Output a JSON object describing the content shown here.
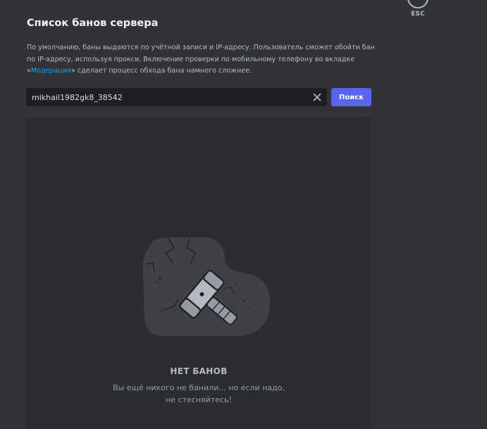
{
  "close": {
    "label": "ESC"
  },
  "page_title": "Список банов сервера",
  "description": {
    "line1": "По умолчанию, баны выдаются по учётной записи и IP-адресу. Пользователь сможет обойти бан",
    "line2": "по IP-адресу, используя прокси. Включение проверки по мобильному телефону во вкладке",
    "line3_open_quote": "«",
    "line3_link": "Модерация",
    "line3_rest": "» сделает процесс обхода бана намного сложнее."
  },
  "search": {
    "value": "mikhail1982gk8_38542",
    "button_label": "Поиск",
    "clear_icon": "close-icon"
  },
  "empty_state": {
    "illustration": "ban-hammer-icon",
    "title": "НЕТ БАНОВ",
    "subtitle_line1": "Вы ещё никого не банили... но если надо,",
    "subtitle_line2": "не стесняйтесь!"
  },
  "colors": {
    "background": "#313338",
    "panel": "#2b2d31",
    "input": "#1e1f22",
    "accent": "#5865f2",
    "link": "#00a8fc"
  }
}
